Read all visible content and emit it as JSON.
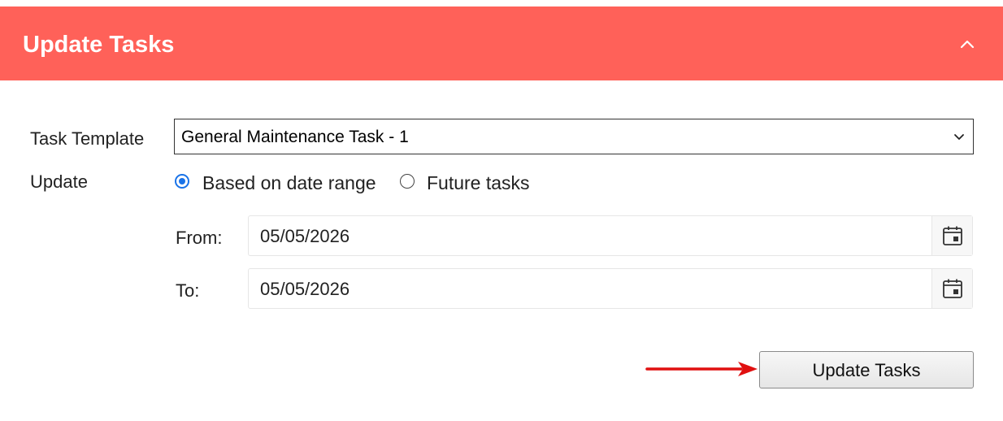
{
  "header": {
    "title": "Update Tasks",
    "color": "#ff6159",
    "collapse_icon": "chevron-up-icon"
  },
  "form": {
    "task_template": {
      "label": "Task Template",
      "selected": "General Maintenance Task - 1"
    },
    "update": {
      "label": "Update",
      "options": [
        {
          "label": "Based on date range",
          "checked": true
        },
        {
          "label": "Future tasks",
          "checked": false
        }
      ]
    },
    "from": {
      "label": "From:",
      "value": "05/05/2026",
      "icon": "calendar-icon"
    },
    "to": {
      "label": "To:",
      "value": "05/05/2026",
      "icon": "calendar-icon"
    }
  },
  "actions": {
    "update_label": "Update Tasks"
  },
  "annotation": {
    "arrow_color": "#e01010"
  }
}
